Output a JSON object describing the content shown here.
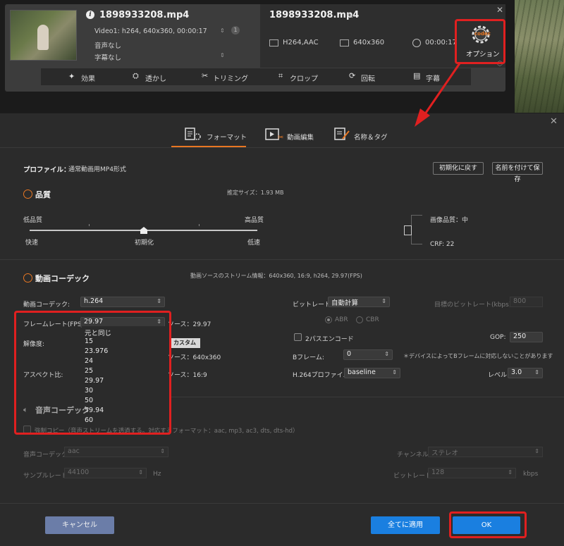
{
  "file": {
    "name": "1898933208.mp4",
    "video_info": "Video1: h264, 640x360, 00:00:17",
    "audio_info": "音声なし",
    "subtitle_info": "字幕なし",
    "track_count": "1",
    "output_name": "1898933208.mp4",
    "output_codec": "H264,AAC",
    "output_resolution": "640x360",
    "output_duration": "00:00:17"
  },
  "options_button": {
    "codec_label": "codec",
    "label": "オプション"
  },
  "toolbar": {
    "items": [
      {
        "label": "効果",
        "icon": "magic-wand-icon"
      },
      {
        "label": "透かし",
        "icon": "watermark-icon"
      },
      {
        "label": "トリミング",
        "icon": "scissors-icon"
      },
      {
        "label": "クロップ",
        "icon": "crop-icon"
      },
      {
        "label": "回転",
        "icon": "rotate-icon"
      },
      {
        "label": "字幕",
        "icon": "subtitle-icon"
      }
    ]
  },
  "tabs": [
    {
      "label": "フォーマット",
      "icon": "format-icon"
    },
    {
      "label": "動画編集",
      "icon": "video-edit-icon"
    },
    {
      "label": "名称＆タグ",
      "icon": "tag-edit-icon"
    }
  ],
  "profile": {
    "label": "プロファイル：",
    "value": "通常動画用MP4形式",
    "reset_btn": "初期化に戻す",
    "save_as_btn": "名前を付けて保存"
  },
  "quality": {
    "title": "品質",
    "estimated_size": "推定サイズ：1.93 MB",
    "low": "低品質",
    "high": "高品質",
    "fast": "快速",
    "default": "初期化",
    "slow": "低速",
    "image_quality": "画像品質：中",
    "crf": "CRF: 22"
  },
  "video_codec_section": {
    "title": "動画コーデック",
    "source_info": "動画ソースのストリーム情報：640x360, 16:9, h264, 29.97(FPS)",
    "codec_label": "動画コーデック:",
    "codec_value": "h.264",
    "framerate_label": "フレームレート(FPS):",
    "framerate_value": "29.97",
    "framerate_source": "ソース：29.97",
    "resolution_label": "解像度:",
    "custom_btn": "カスタム",
    "resolution_source": "ソース：640x360",
    "aspect_label": "アスペクト比:",
    "aspect_source": "ソース：16:9",
    "framerate_options": [
      "元と同じ",
      "15",
      "23.976",
      "24",
      "25",
      "29.97",
      "30",
      "50",
      "59.94",
      "60"
    ],
    "bitrate_label": "ビットレート:",
    "bitrate_value": "自動計算",
    "target_bitrate_label": "目標のビットレート(kbps):",
    "target_bitrate_value": "800",
    "abr": "ABR",
    "cbr": "CBR",
    "twopass_label": "2パスエンコード",
    "gop_label": "GOP:",
    "gop_value": "250",
    "bframe_label": "Bフレーム:",
    "bframe_value": "0",
    "bframe_note": "＊デバイスによってBフレームに対応しないことがあります",
    "profile_label": "H.264プロファイル:",
    "profile_value": "baseline",
    "level_label": "レベル:",
    "level_value": "3.0"
  },
  "audio_section": {
    "title": "音声コーデック",
    "force_copy": "強制コピー（音声ストリームを透過する。対応するフォーマット：aac, mp3, ac3, dts, dts-hd）",
    "codec_label": "音声コーデック:",
    "codec_value": "aac",
    "channel_label": "チャンネル:",
    "channel_value": "ステレオ",
    "samplerate_label": "サンプルレート:",
    "samplerate_value": "44100",
    "samplerate_unit": "Hz",
    "bitrate_label": "ビットレート:",
    "bitrate_value": "128",
    "bitrate_unit": "kbps"
  },
  "footer": {
    "cancel": "キャンセル",
    "apply_all": "全てに適用",
    "ok": "OK"
  },
  "colors": {
    "accent_orange": "#e87722",
    "highlight_red": "#e02020",
    "primary_blue": "#1a7fe0",
    "cancel_blue": "#6b7da8"
  }
}
